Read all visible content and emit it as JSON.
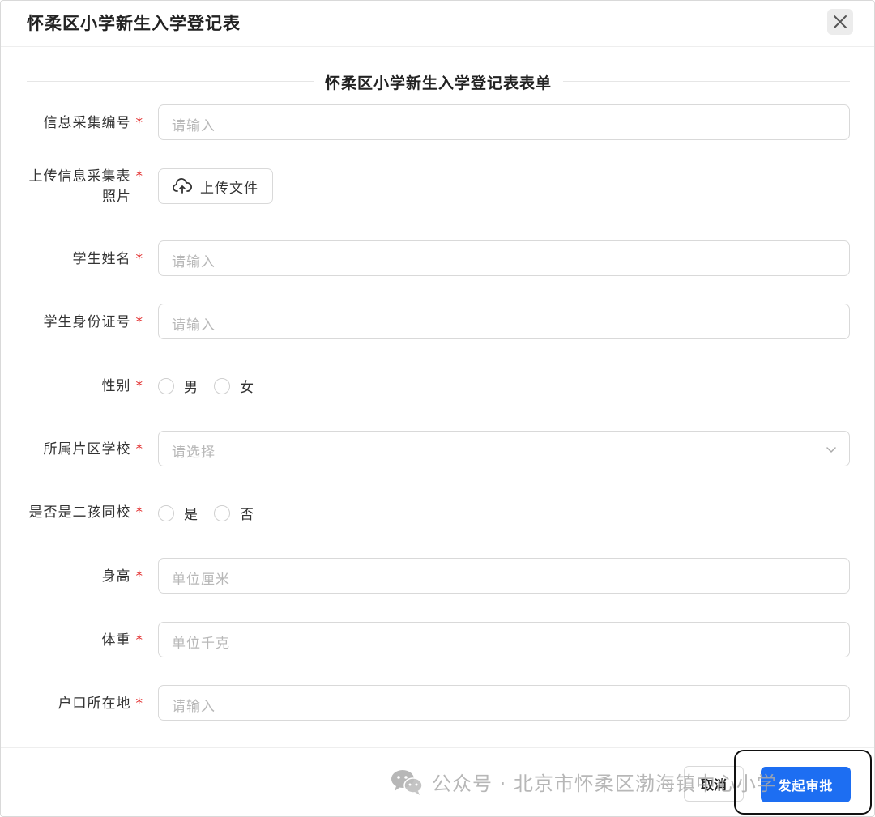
{
  "dialog": {
    "title": "怀柔区小学新生入学登记表",
    "close_icon": "close-icon"
  },
  "form": {
    "section_title": "怀柔区小学新生入学登记表表单",
    "required_mark": "*",
    "fields": {
      "collection_no": {
        "label": "信息采集编号",
        "placeholder": "请输入"
      },
      "photo": {
        "label_line1": "上传信息采集表",
        "label_line2": "照片",
        "button_label": "上传文件",
        "icon": "cloud-upload-icon"
      },
      "student_name": {
        "label": "学生姓名",
        "placeholder": "请输入"
      },
      "student_id": {
        "label": "学生身份证号",
        "placeholder": "请输入"
      },
      "gender": {
        "label": "性别",
        "options": [
          "男",
          "女"
        ]
      },
      "district_school": {
        "label": "所属片区学校",
        "placeholder": "请选择",
        "icon": "chevron-down-icon"
      },
      "second_child": {
        "label": "是否是二孩同校",
        "options": [
          "是",
          "否"
        ]
      },
      "height": {
        "label": "身高",
        "placeholder": "单位厘米"
      },
      "weight": {
        "label": "体重",
        "placeholder": "单位千克"
      },
      "household": {
        "label": "户口所在地",
        "placeholder": "请输入"
      }
    }
  },
  "footer": {
    "cancel_label": "取消",
    "submit_label": "发起审批",
    "watermark_text": "公众号 · 北京市怀柔区渤海镇中心小学",
    "watermark_icon": "wechat-icon",
    "colors": {
      "primary": "#1d6ef2",
      "required": "#e02020"
    }
  }
}
